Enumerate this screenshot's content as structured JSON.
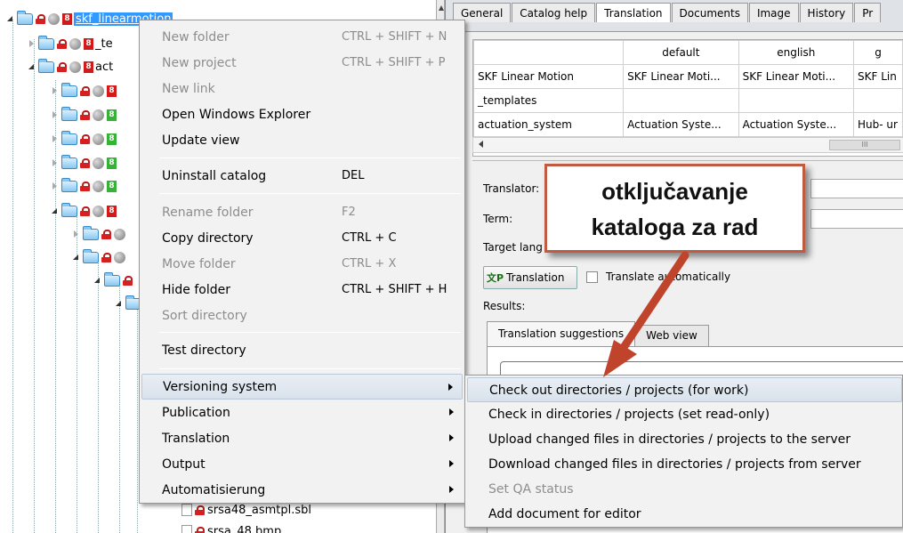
{
  "tree": {
    "root_label": "skf_linearmotion",
    "row2_label": "_te",
    "row3_label": "act",
    "file1_label": "srsa48_asmtpl.sbl",
    "file2_label": "srsa_48.bmp"
  },
  "tabs": [
    "General",
    "Catalog help",
    "Translation",
    "Documents",
    "Image",
    "History",
    "Pr"
  ],
  "grid": {
    "headers": [
      "",
      "default",
      "english",
      "g"
    ],
    "rows": [
      [
        "SKF Linear Motion",
        "SKF Linear Moti...",
        "SKF Linear Moti...",
        "SKF Lin"
      ],
      [
        "_templates",
        "",
        "",
        ""
      ],
      [
        "actuation_system",
        "Actuation Syste...",
        "Actuation Syste...",
        "Hub- ur"
      ]
    ],
    "scroll_grip": "III"
  },
  "form": {
    "translator_label": "Translator:",
    "term_label": "Term:",
    "target_label": "Target lang",
    "translation_button": "Translation",
    "translation_icon_glyph": "文P",
    "auto_label": "Translate automatically",
    "results_label": "Results:",
    "subtab_suggestions": "Translation suggestions",
    "subtab_web": "Web view"
  },
  "context_menu": {
    "new_folder": "New folder",
    "new_folder_sc": "CTRL + SHIFT + N",
    "new_project": "New project",
    "new_project_sc": "CTRL + SHIFT + P",
    "new_link": "New link",
    "open_explorer": "Open Windows Explorer",
    "update_view": "Update view",
    "uninstall": "Uninstall catalog",
    "uninstall_sc": "DEL",
    "rename": "Rename folder",
    "rename_sc": "F2",
    "copy_dir": "Copy directory",
    "copy_dir_sc": "CTRL + C",
    "move": "Move folder",
    "move_sc": "CTRL + X",
    "hide": "Hide folder",
    "hide_sc": "CTRL + SHIFT + H",
    "sort": "Sort directory",
    "test": "Test directory",
    "versioning": "Versioning system",
    "publication": "Publication",
    "translation": "Translation",
    "output": "Output",
    "automatisierung": "Automatisierung"
  },
  "submenu": {
    "check_out": "Check out directories / projects (for work)",
    "check_in": "Check in directories / projects (set read-only)",
    "upload": "Upload changed files in directories / projects to the server",
    "download": "Download changed files in directories / projects from server",
    "qa": "Set QA status",
    "add_doc": "Add document for editor"
  },
  "callout": {
    "line1": "otključavanje",
    "line2": "kataloga za rad"
  },
  "colors": {
    "annotation_border": "#c05a40",
    "arrow": "#c0442c",
    "selection": "#3399ff"
  }
}
